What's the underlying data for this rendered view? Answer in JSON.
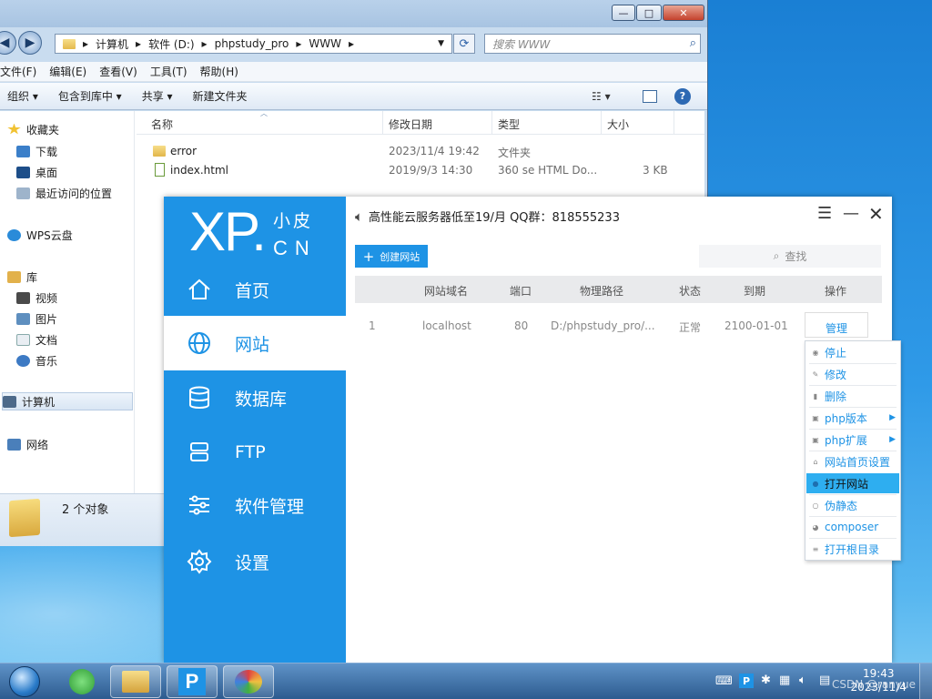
{
  "explorer": {
    "breadcrumb": [
      "计算机",
      "软件 (D:)",
      "phpstudy_pro",
      "WWW"
    ],
    "search_placeholder": "搜索 WWW",
    "menu": [
      "文件(F)",
      "编辑(E)",
      "查看(V)",
      "工具(T)",
      "帮助(H)"
    ],
    "toolbar": [
      "组织 ▾",
      "包含到库中 ▾",
      "共享 ▾",
      "新建文件夹"
    ],
    "nav": {
      "favorites": "收藏夹",
      "downloads": "下载",
      "desktop": "桌面",
      "recent": "最近访问的位置",
      "wps": "WPS云盘",
      "libraries": "库",
      "videos": "视频",
      "pictures": "图片",
      "documents": "文档",
      "music": "音乐",
      "computer": "计算机",
      "network": "网络"
    },
    "columns": {
      "name": "名称",
      "date": "修改日期",
      "type": "类型",
      "size": "大小"
    },
    "files": [
      {
        "name": "error",
        "date": "2023/11/4 19:42",
        "type": "文件夹",
        "size": ""
      },
      {
        "name": "index.html",
        "date": "2019/9/3 14:30",
        "type": "360 se HTML Do...",
        "size": "3 KB"
      }
    ],
    "status": "2 个对象"
  },
  "phpstudy": {
    "logo": {
      "big": "XP.",
      "cn1": "小皮",
      "cn2": "CN"
    },
    "nav": [
      "首页",
      "网站",
      "数据库",
      "FTP",
      "软件管理",
      "设置"
    ],
    "active_nav": "网站",
    "notice": "高性能云服务器低至19/月  QQ群：818555233",
    "create_button": "创建网站",
    "search_placeholder": "查找",
    "table_headers": [
      "网站域名",
      "端口",
      "物理路径",
      "状态",
      "到期",
      "操作"
    ],
    "rows": [
      {
        "index": "1",
        "domain": "localhost",
        "port": "80",
        "path": "D:/phpstudy_pro/...",
        "status": "正常",
        "expire": "2100-01-01",
        "action": "管理"
      }
    ],
    "context_menu": [
      "停止",
      "修改",
      "删除",
      "php版本",
      "php扩展",
      "网站首页设置",
      "打开网站",
      "伪静态",
      "composer",
      "打开根目录"
    ],
    "highlighted_menu_item": "打开网站",
    "accent_color": "#1e93e5"
  },
  "taskbar": {
    "time": "19:43",
    "date": "2023/11/4",
    "watermark": "CSDN @ranyue"
  }
}
